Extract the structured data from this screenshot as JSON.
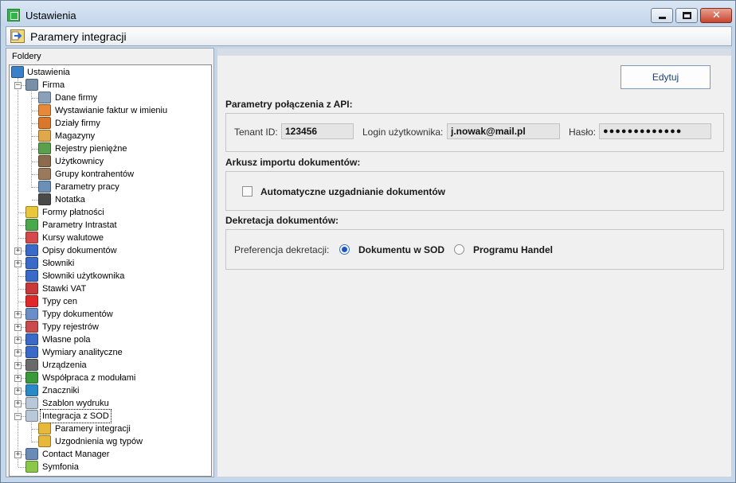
{
  "window": {
    "title": "Ustawienia",
    "close_glyph": "✕"
  },
  "header": {
    "title": "Paramery integracji",
    "icon": "integration-arrow-icon"
  },
  "sidebar": {
    "label": "Foldery",
    "items": [
      {
        "label": "Ustawienia",
        "icon": "tools-icon",
        "color": "#3a7fc8"
      },
      {
        "label": "Firma",
        "icon": "building-icon",
        "color": "#7a8fa8",
        "expander": "−"
      },
      {
        "label": "Dane firmy",
        "icon": "building-icon",
        "color": "#8aa0bb"
      },
      {
        "label": "Wystawianie faktur w imieniu",
        "icon": "person-icon",
        "color": "#e68a3a"
      },
      {
        "label": "Działy firmy",
        "icon": "house-icon",
        "color": "#d9772b"
      },
      {
        "label": "Magazyny",
        "icon": "warehouse-icon",
        "color": "#e0a84a"
      },
      {
        "label": "Rejestry pieniężne",
        "icon": "money-icon",
        "color": "#5aa04a"
      },
      {
        "label": "Użytkownicy",
        "icon": "users-icon",
        "color": "#8a6a4a"
      },
      {
        "label": "Grupy kontrahentów",
        "icon": "group-icon",
        "color": "#9a7a5a"
      },
      {
        "label": "Parametry pracy",
        "icon": "parameters-icon",
        "color": "#6a8fb8"
      },
      {
        "label": "Notatka",
        "icon": "note-icon",
        "color": "#4a4a4a"
      },
      {
        "label": "Formy płatności",
        "icon": "payment-icon",
        "color": "#e8c83a"
      },
      {
        "label": "Parametry Intrastat",
        "icon": "intrastat-icon",
        "color": "#4aa84a"
      },
      {
        "label": "Kursy walutowe",
        "icon": "currency-chart-icon",
        "color": "#d44a4a"
      },
      {
        "label": "Opisy dokumentów",
        "icon": "document-description-icon",
        "color": "#3a6ac8",
        "expander": "+"
      },
      {
        "label": "Słowniki",
        "icon": "dictionary-icon",
        "color": "#3a6ac8",
        "expander": "+"
      },
      {
        "label": "Słowniki użytkownika",
        "icon": "user-dictionary-icon",
        "color": "#3a6ac8"
      },
      {
        "label": "Stawki VAT",
        "icon": "vat-icon",
        "color": "#c83a3a"
      },
      {
        "label": "Typy cen",
        "icon": "price-type-icon",
        "color": "#e02828"
      },
      {
        "label": "Typy dokumentów",
        "icon": "document-types-icon",
        "color": "#6a8fc8",
        "expander": "+"
      },
      {
        "label": "Typy rejestrów",
        "icon": "register-types-icon",
        "color": "#c84a4a",
        "expander": "+"
      },
      {
        "label": "Własne pola",
        "icon": "custom-fields-icon",
        "color": "#3a6ac8",
        "expander": "+"
      },
      {
        "label": "Wymiary analityczne",
        "icon": "analytic-dimensions-icon",
        "color": "#3a6ac8",
        "expander": "+"
      },
      {
        "label": "Urządzenia",
        "icon": "printer-icon",
        "color": "#6a6a6a",
        "expander": "+"
      },
      {
        "label": "Współpraca z modułami",
        "icon": "modules-icon",
        "color": "#3a9a3a",
        "expander": "+"
      },
      {
        "label": "Znaczniki",
        "icon": "tags-icon",
        "color": "#2a8ac8",
        "expander": "+"
      },
      {
        "label": "Szablon wydruku",
        "icon": "folder-icon",
        "color": "#b8c8d8",
        "expander": "+"
      },
      {
        "label": "Integracja z SOD",
        "icon": "folder-icon",
        "color": "#b8c8d8",
        "expander": "−",
        "selected": true
      },
      {
        "label": "Paramery integracji",
        "icon": "integration-arrow-icon",
        "color": "#e8b83a"
      },
      {
        "label": "Uzgodnienia wg typów",
        "icon": "integration-arrow-icon",
        "color": "#e8b83a"
      },
      {
        "label": "Contact Manager",
        "icon": "contact-manager-icon",
        "color": "#6a8ab8",
        "expander": "+"
      },
      {
        "label": "Symfonia",
        "icon": "symfonia-icon",
        "color": "#8ac84a"
      }
    ]
  },
  "toolbar": {
    "edit_label": "Edytuj"
  },
  "api": {
    "section_title": "Parametry połączenia z API:",
    "tenant_label": "Tenant ID:",
    "tenant_value": "123456",
    "login_label": "Login użytkownika:",
    "login_value": "j.nowak@mail.pl",
    "password_label": "Hasło:",
    "password_value": "●●●●●●●●●●●●●"
  },
  "import": {
    "section_title": "Arkusz importu dokumentów:",
    "auto_match_label": "Automatyczne uzgadnianie dokumentów",
    "auto_match_checked": false
  },
  "decree": {
    "section_title": "Dekretacja dokumentów:",
    "preference_label": "Preferencja dekretacji:",
    "options": [
      {
        "label": "Dokumentu w SOD",
        "selected": true
      },
      {
        "label": "Programu Handel",
        "selected": false
      }
    ]
  },
  "colors": {
    "window_frame": "#c5d7ea",
    "accent": "#1b56c4",
    "edit_text": "#1f3e6b"
  }
}
